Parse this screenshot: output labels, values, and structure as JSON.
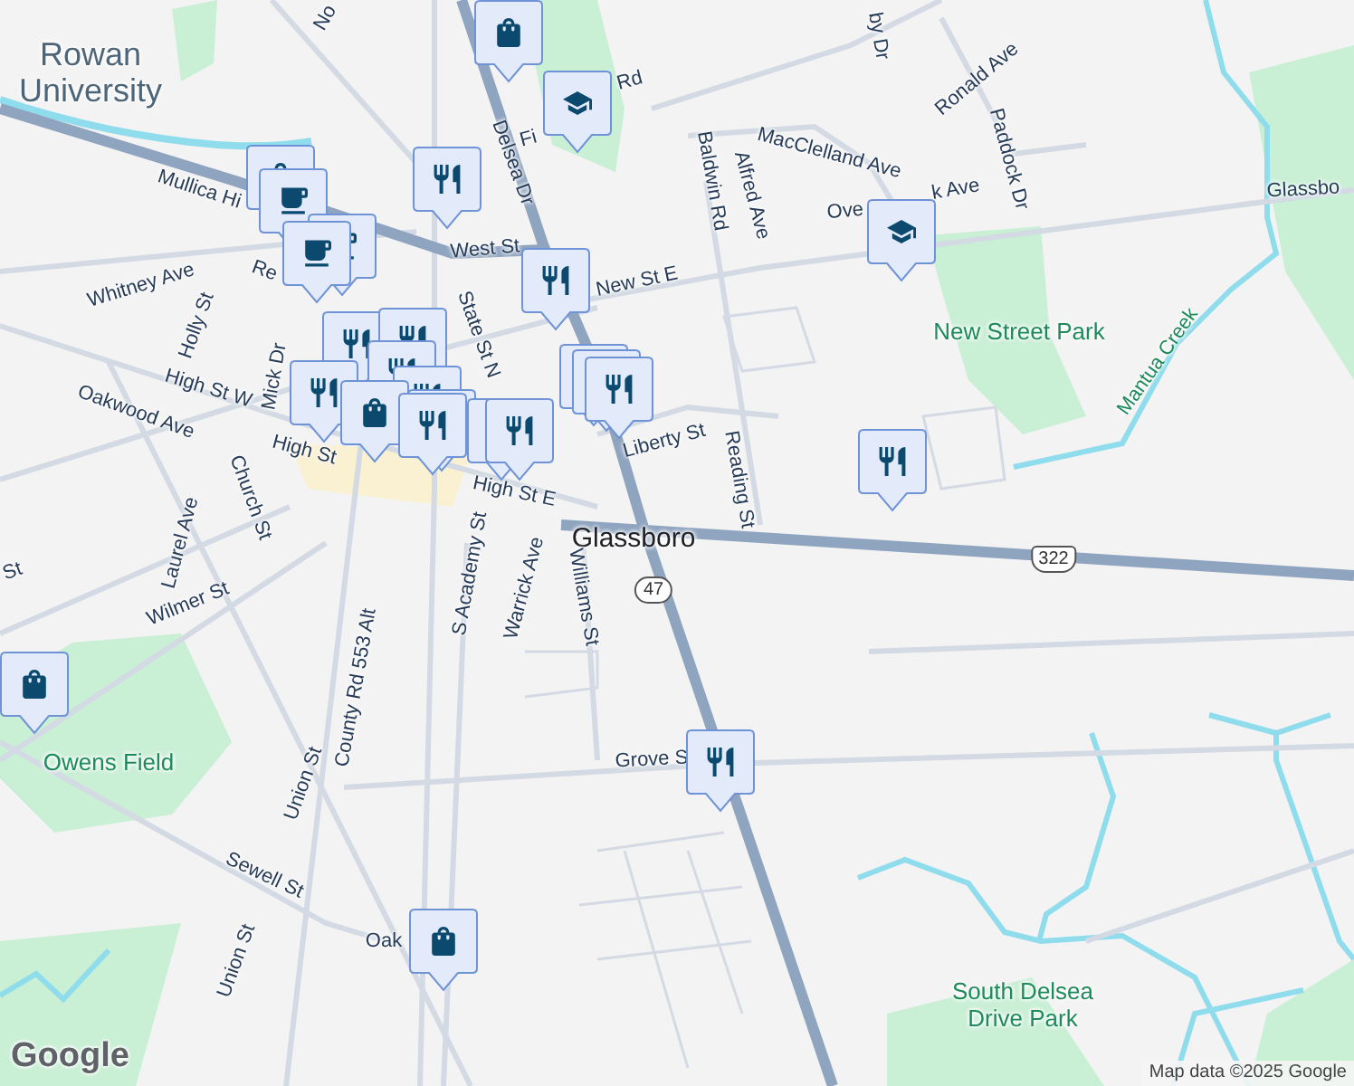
{
  "map": {
    "labels": [
      {
        "text": "Rowan University",
        "kind": "place"
      },
      {
        "text": "No",
        "kind": "street"
      },
      {
        "text": "Fi",
        "kind": "street"
      },
      {
        "text": "Rd",
        "kind": "street"
      },
      {
        "text": "Delsea Dr",
        "kind": "street"
      },
      {
        "text": "Mullica Hi",
        "kind": "street"
      },
      {
        "text": "West St",
        "kind": "street"
      },
      {
        "text": "Baldwin Rd",
        "kind": "street"
      },
      {
        "text": "Alfred Ave",
        "kind": "street"
      },
      {
        "text": "MacClelland Ave",
        "kind": "street"
      },
      {
        "text": "Ronald Ave",
        "kind": "street"
      },
      {
        "text": "by Dr",
        "kind": "street"
      },
      {
        "text": "Paddock Dr",
        "kind": "street"
      },
      {
        "text": "Ove",
        "kind": "street"
      },
      {
        "text": "k Ave",
        "kind": "street"
      },
      {
        "text": "Glassbo",
        "kind": "street"
      },
      {
        "text": "Re",
        "kind": "street"
      },
      {
        "text": "Whitney Ave",
        "kind": "street"
      },
      {
        "text": "State St N",
        "kind": "street"
      },
      {
        "text": "New St E",
        "kind": "street"
      },
      {
        "text": "Holly St",
        "kind": "street"
      },
      {
        "text": "Mick Dr",
        "kind": "street"
      },
      {
        "text": "High St W",
        "kind": "street"
      },
      {
        "text": "Oakwood Ave",
        "kind": "street"
      },
      {
        "text": "High St",
        "kind": "street"
      },
      {
        "text": "Liberty St",
        "kind": "street"
      },
      {
        "text": "Church St",
        "kind": "street"
      },
      {
        "text": "High St E",
        "kind": "street"
      },
      {
        "text": "Reading St",
        "kind": "street"
      },
      {
        "text": "Glassboro",
        "kind": "town"
      },
      {
        "text": "Laurel Ave",
        "kind": "street"
      },
      {
        "text": "St",
        "kind": "street"
      },
      {
        "text": "S Academy St",
        "kind": "street"
      },
      {
        "text": "Warrick Ave",
        "kind": "street"
      },
      {
        "text": "Williams St",
        "kind": "street"
      },
      {
        "text": "Wilmer St",
        "kind": "street"
      },
      {
        "text": "County Rd 553 Alt",
        "kind": "street"
      },
      {
        "text": "Union St",
        "kind": "street"
      },
      {
        "text": "Grove S",
        "kind": "street"
      },
      {
        "text": "Sewell St",
        "kind": "street"
      },
      {
        "text": "Oak",
        "kind": "street"
      },
      {
        "text": "Union St",
        "kind": "street"
      },
      {
        "text": "New Street Park",
        "kind": "park"
      },
      {
        "text": "Owens Field",
        "kind": "park"
      },
      {
        "text": "South Delsea Drive Park",
        "kind": "park"
      },
      {
        "text": "Mantua Creek",
        "kind": "water"
      }
    ],
    "shields": [
      {
        "text": "322",
        "kind": "us"
      },
      {
        "text": "47",
        "kind": "state"
      }
    ],
    "pin_groups": [
      {
        "pins": [
          {
            "kind": "shopping"
          }
        ]
      },
      {
        "pins": [
          {
            "kind": "school"
          }
        ]
      },
      {
        "pins": [
          {
            "kind": "restaurant"
          }
        ]
      },
      {
        "pins": [
          {
            "kind": "shopping"
          },
          {
            "kind": "cafe"
          },
          {
            "kind": "cafe"
          },
          {
            "kind": "cafe"
          }
        ]
      },
      {
        "pins": [
          {
            "kind": "restaurant"
          },
          {
            "kind": "restaurant"
          },
          {
            "kind": "restaurant"
          },
          {
            "kind": "restaurant"
          },
          {
            "kind": "restaurant"
          },
          {
            "kind": "restaurant"
          },
          {
            "kind": "shopping"
          },
          {
            "kind": "restaurant"
          },
          {
            "kind": "restaurant"
          },
          {
            "kind": "restaurant"
          }
        ]
      },
      {
        "pins": [
          {
            "kind": "restaurant"
          }
        ]
      },
      {
        "pins": [
          {
            "kind": "restaurant"
          },
          {
            "kind": "restaurant"
          },
          {
            "kind": "restaurant"
          }
        ]
      },
      {
        "pins": [
          {
            "kind": "school"
          }
        ]
      },
      {
        "pins": [
          {
            "kind": "restaurant"
          }
        ]
      },
      {
        "pins": [
          {
            "kind": "shopping"
          }
        ]
      },
      {
        "pins": [
          {
            "kind": "restaurant"
          }
        ]
      },
      {
        "pins": [
          {
            "kind": "shopping"
          }
        ]
      }
    ],
    "logo": "Google",
    "attribution": "Map data ©2025 Google"
  }
}
